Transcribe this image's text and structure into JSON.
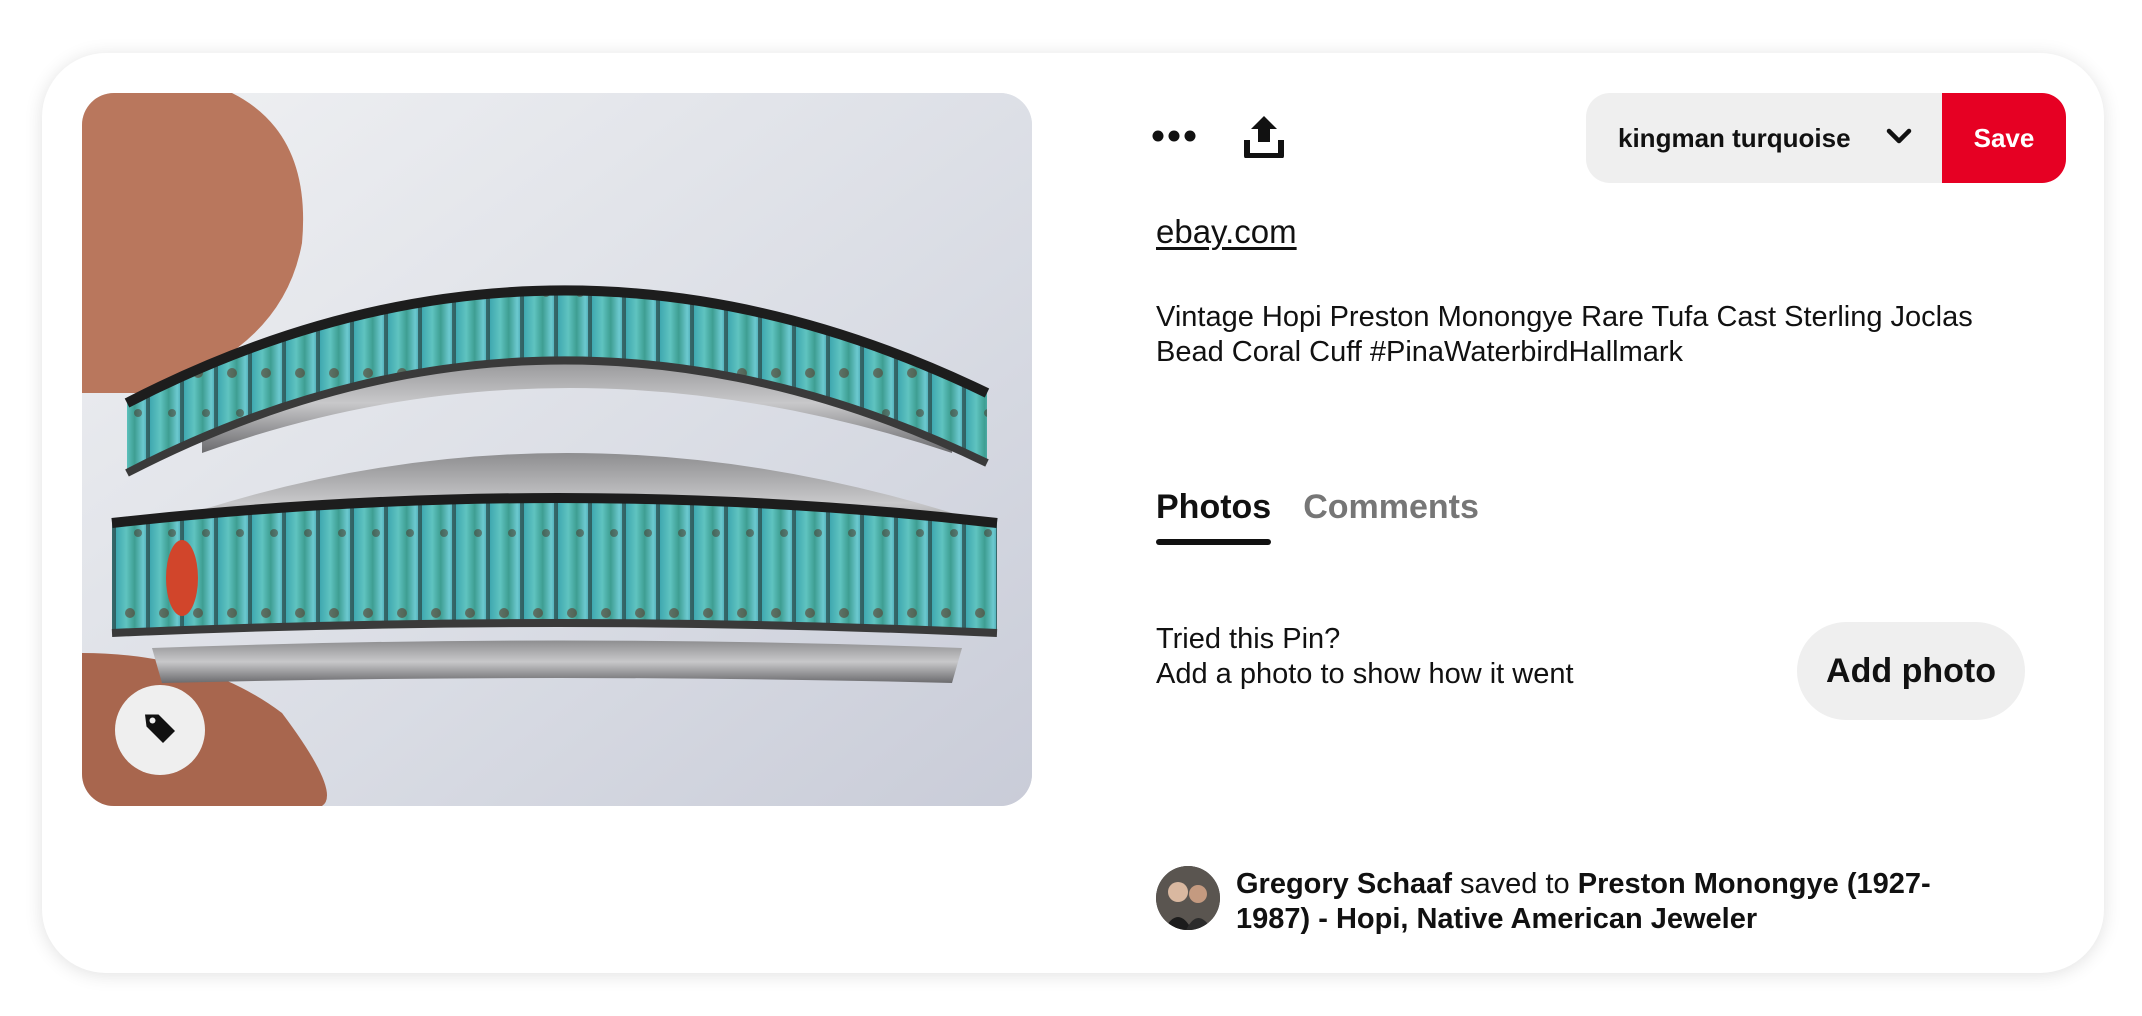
{
  "pin": {
    "image_alt": "turquoise bead cuff bracelet",
    "tag_icon": "tag-icon"
  },
  "toolbar": {
    "more_icon": "ellipsis-icon",
    "share_icon": "share-upload-icon",
    "board_name": "kingman turquoise",
    "board_chevron_icon": "chevron-down-icon",
    "save_label": "Save",
    "save_color": "#e60023"
  },
  "source": {
    "domain": "ebay.com"
  },
  "description": "Vintage Hopi Preston Monongye Rare Tufa Cast Sterling Joclas Bead Coral Cuff #PinaWaterbirdHallmark",
  "tabs": [
    {
      "label": "Photos",
      "active": true
    },
    {
      "label": "Comments",
      "active": false
    }
  ],
  "tried": {
    "line1": "Tried this Pin?",
    "line2": "Add a photo to show how it went",
    "button_label": "Add photo"
  },
  "saver": {
    "name": "Gregory Schaaf",
    "connector": "saved to",
    "board": "Preston Monongye (1927-1987) - Hopi, Native American Jeweler"
  }
}
